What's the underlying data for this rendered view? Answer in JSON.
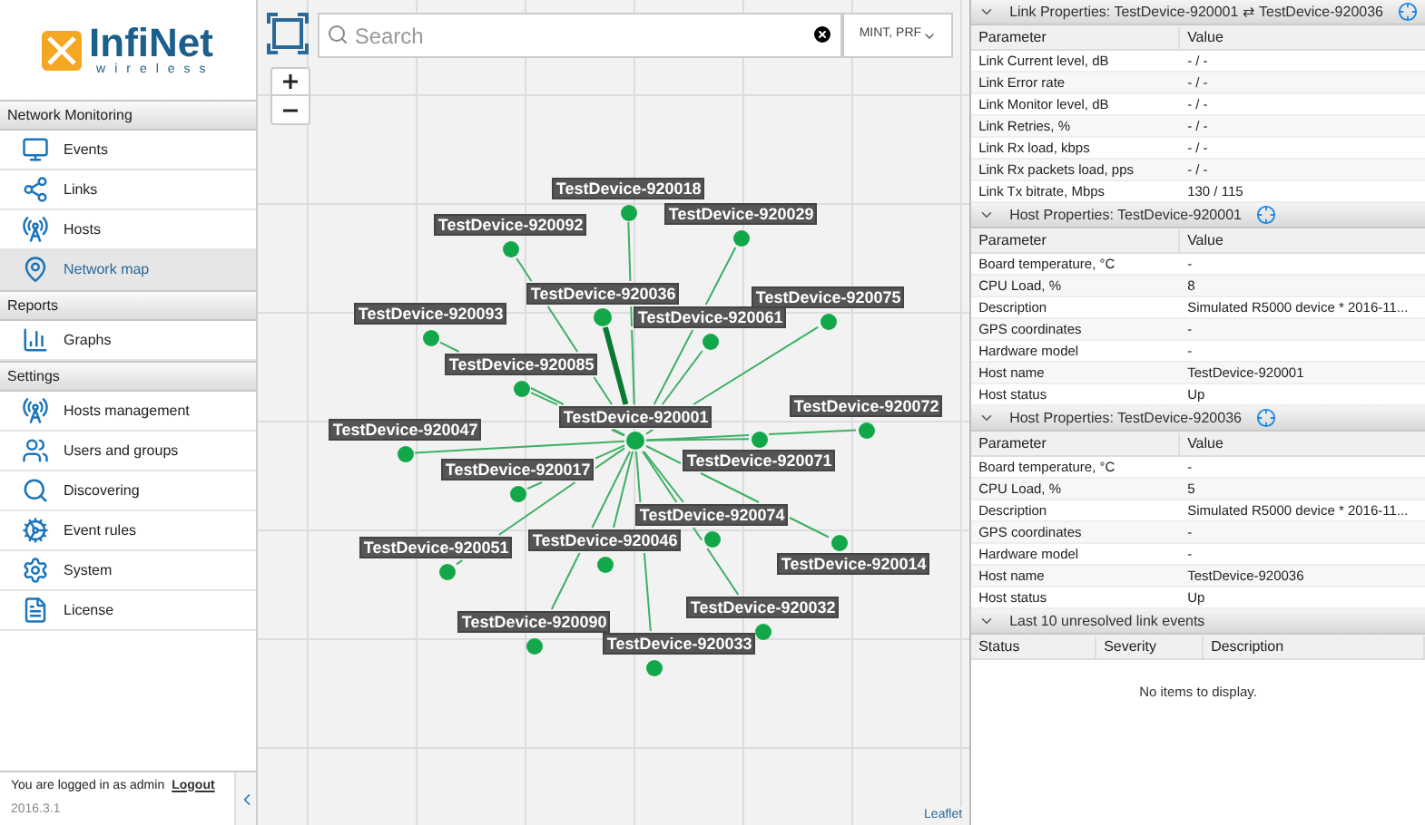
{
  "logo": {
    "name": "InfiNet",
    "tagline": "wireless"
  },
  "sidebar": {
    "sections": [
      {
        "title": "Network Monitoring",
        "items": [
          {
            "label": "Events",
            "selected": false
          },
          {
            "label": "Links",
            "selected": false
          },
          {
            "label": "Hosts",
            "selected": false
          },
          {
            "label": "Network map",
            "selected": true
          }
        ]
      },
      {
        "title": "Reports",
        "items": [
          {
            "label": "Graphs",
            "selected": false
          }
        ]
      },
      {
        "title": "Settings",
        "items": [
          {
            "label": "Hosts management",
            "selected": false
          },
          {
            "label": "Users and groups",
            "selected": false
          },
          {
            "label": "Discovering",
            "selected": false
          },
          {
            "label": "Event rules",
            "selected": false
          },
          {
            "label": "System",
            "selected": false
          },
          {
            "label": "License",
            "selected": false
          }
        ]
      }
    ],
    "footer": {
      "text": "You are logged in as admin",
      "link": "Logout",
      "version": "2016.3.1"
    }
  },
  "map": {
    "search": {
      "placeholder": "Search"
    },
    "filter": "MINT, PRF",
    "attribution": "Leaflet",
    "nodes": [
      {
        "label": "TestDevice-920018",
        "kind": "device",
        "selected": false
      },
      {
        "label": "TestDevice-920029",
        "kind": "device",
        "selected": false
      },
      {
        "label": "TestDevice-920092",
        "kind": "device",
        "selected": false
      },
      {
        "label": "TestDevice-920036",
        "kind": "device",
        "selected": true
      },
      {
        "label": "TestDevice-920061",
        "kind": "device",
        "selected": false
      },
      {
        "label": "TestDevice-920075",
        "kind": "device",
        "selected": false
      },
      {
        "label": "TestDevice-920093",
        "kind": "device",
        "selected": false
      },
      {
        "label": "TestDevice-920085",
        "kind": "device",
        "selected": false
      },
      {
        "label": "TestDevice-920071",
        "kind": "device",
        "selected": false
      },
      {
        "label": "TestDevice-920072",
        "kind": "device",
        "selected": false
      },
      {
        "label": "TestDevice-920047",
        "kind": "device",
        "selected": false
      },
      {
        "label": "TestDevice-920017",
        "kind": "device",
        "selected": false
      },
      {
        "label": "TestDevice-920074",
        "kind": "device",
        "selected": false
      },
      {
        "label": "TestDevice-920014",
        "kind": "device",
        "selected": false
      },
      {
        "label": "TestDevice-920046",
        "kind": "device",
        "selected": false
      },
      {
        "label": "TestDevice-920051",
        "kind": "device",
        "selected": false
      },
      {
        "label": "TestDevice-920032",
        "kind": "device",
        "selected": false
      },
      {
        "label": "TestDevice-920090",
        "kind": "device",
        "selected": false
      },
      {
        "label": "TestDevice-920033",
        "kind": "device",
        "selected": false
      },
      {
        "label": "TestDevice-920001",
        "kind": "hub"
      }
    ]
  },
  "panels": [
    {
      "title": "Link Properties: TestDevice-920001 ⇄ TestDevice-920036",
      "columns": [
        "Parameter",
        "Value"
      ],
      "rows": [
        [
          "Link Current level, dB",
          "- / -"
        ],
        [
          "Link Error rate",
          "- / -"
        ],
        [
          "Link Monitor level, dB",
          "- / -"
        ],
        [
          "Link Retries, %",
          "- / -"
        ],
        [
          "Link Rx load, kbps",
          "- / -"
        ],
        [
          "Link Rx packets load, pps",
          "- / -"
        ],
        [
          "Link Tx bitrate, Mbps",
          "130 / 115"
        ]
      ]
    },
    {
      "title": "Host Properties: TestDevice-920001",
      "columns": [
        "Parameter",
        "Value"
      ],
      "rows": [
        [
          "Board temperature, °C",
          "-"
        ],
        [
          "CPU Load, %",
          "8"
        ],
        [
          "Description",
          "Simulated R5000 device * 2016-11..."
        ],
        [
          "GPS coordinates",
          "-"
        ],
        [
          "Hardware model",
          "-"
        ],
        [
          "Host name",
          "TestDevice-920001"
        ],
        [
          "Host status",
          "Up"
        ]
      ]
    },
    {
      "title": "Host Properties: TestDevice-920036",
      "columns": [
        "Parameter",
        "Value"
      ],
      "rows": [
        [
          "Board temperature, °C",
          "-"
        ],
        [
          "CPU Load, %",
          "5"
        ],
        [
          "Description",
          "Simulated R5000 device * 2016-11..."
        ],
        [
          "GPS coordinates",
          "-"
        ],
        [
          "Hardware model",
          "-"
        ],
        [
          "Host name",
          "TestDevice-920036"
        ],
        [
          "Host status",
          "Up"
        ]
      ]
    }
  ],
  "events": {
    "title": "Last 10 unresolved link events",
    "columns": [
      "Status",
      "Severity",
      "Description"
    ],
    "empty": "No items to display."
  }
}
